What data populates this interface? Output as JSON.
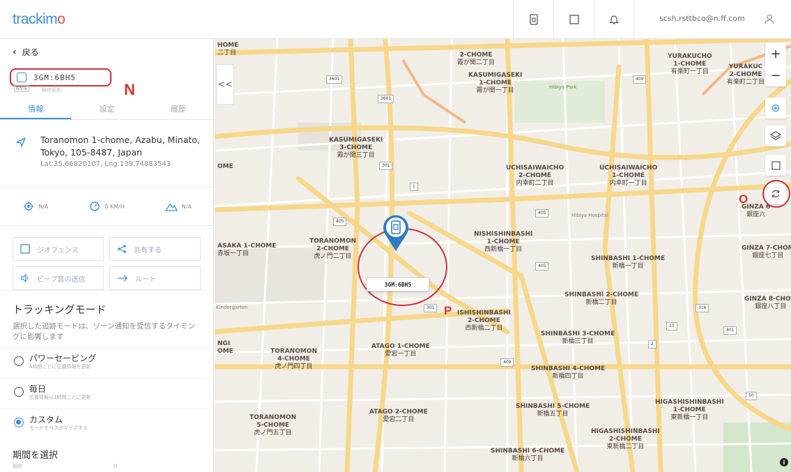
{
  "app": {
    "logo_text": "trackim",
    "logo_accent": "o",
    "user_email": "scsh.rsttbco@n.ff.com"
  },
  "panel": {
    "back_label": "戻る",
    "device_name": "3GM:6BH5",
    "battery": "65%",
    "device_sub": "最終更新",
    "annotation_n": "N",
    "tabs": [
      {
        "label": "情報"
      },
      {
        "label": "設定"
      },
      {
        "label": "履歴"
      }
    ],
    "address_line1": "Toranomon 1-chome, Azabu, Minato,",
    "address_line2": "Tokyo, 105-8487, Japan",
    "latlng": "Lat:35.66820107, Lng:139.74883543",
    "stats": [
      {
        "value": "N/A"
      },
      {
        "value": "0 KM/H"
      },
      {
        "value": "N/A"
      }
    ],
    "actions": [
      {
        "label": "ジオフェンス"
      },
      {
        "label": "共有する"
      },
      {
        "label": "ビープ音の送信"
      },
      {
        "label": "ルート"
      }
    ],
    "tracking_title": "トラッキングモード",
    "tracking_desc": "選択した追跡モードは、ゾーン通知を受信するタイミングに影響します",
    "modes": [
      {
        "name": "パワーセービング",
        "sub": "4時間ごとに位置情報を更新",
        "selected": false
      },
      {
        "name": "毎日",
        "sub": "位置情報は1時間ごとに更新",
        "selected": false
      },
      {
        "name": "カスタム",
        "sub": "モードをカスタマイズする",
        "selected": true
      }
    ],
    "period_title": "期間を選択",
    "period_sub": "期間",
    "period_sub2": "分"
  },
  "map": {
    "device_label": "3GM:6BH5",
    "annotation_o": "O",
    "annotation_p": "P",
    "collapse_label": "<<",
    "zoom_in": "+",
    "zoom_out": "−",
    "labels": [
      {
        "en": "YURAKUCHO\n1-CHOME",
        "jp": "有楽町一丁目"
      },
      {
        "en": "YURAKUC\n2-CHOME",
        "jp": "有楽町二丁目"
      },
      {
        "en": "KASUMIGASEKI\n1-CHOME",
        "jp": "霞が関一丁目"
      },
      {
        "en": "KASUMIGASEKI\n3-CHOME",
        "jp": "霞が関三丁目"
      },
      {
        "en": "UCHISAIWAICHO\n2-CHOME",
        "jp": "内幸町二丁目"
      },
      {
        "en": "UCHISAIWAICHO\n1-CHOME",
        "jp": "内幸町一丁目"
      },
      {
        "en": "NISHISHINBASHI\n1-CHOME",
        "jp": "西新橋一丁目"
      },
      {
        "en": "TORANOMON\n2-CHOME",
        "jp": "虎ノ門二丁目"
      },
      {
        "en": "ASAKA 1-CHOME",
        "jp": "赤坂一丁目"
      },
      {
        "en": "SHINBASHI 1-CHOME",
        "jp": "新橋一丁目"
      },
      {
        "en": "GINZA 7-CHOM",
        "jp": "銀座七丁目"
      },
      {
        "en": "GINZA 8-CHOM",
        "jp": "銀座八丁目"
      },
      {
        "en": "SHINBASHI 2-CHOME",
        "jp": "新橋二丁目"
      },
      {
        "en": "ISHISHINBASHI\n2-CHOME",
        "jp": "西新橋二丁目"
      },
      {
        "en": "SHINBASHI 3-CHOME",
        "jp": "新橋三丁目"
      },
      {
        "en": "ATAGO 1-CHOME",
        "jp": "愛宕一丁目"
      },
      {
        "en": "TORANOMON\n4-CHOME",
        "jp": "虎ノ門四丁目"
      },
      {
        "en": "SHINBASHI 4-CHOME",
        "jp": "新橋四丁目"
      },
      {
        "en": "HIGASHISHINBASHI\n1-CHOME",
        "jp": "東新橋一丁目"
      },
      {
        "en": "SHINBASHI 5-CHOME",
        "jp": "新橋五丁目"
      },
      {
        "en": "ATAGO 2-CHOME",
        "jp": "愛宕二丁目"
      },
      {
        "en": "TORANOMON\n5-CHOME",
        "jp": "虎ノ門五丁目"
      },
      {
        "en": "HIGASHISHINBASHI\n2-CHOME",
        "jp": "東新橋二丁目"
      },
      {
        "en": "SHINBASHI 6-CHOME",
        "jp": "新橋六丁目"
      },
      {
        "en": "GINZA 6",
        "jp": "銀座六"
      },
      {
        "en": "2-CHOME",
        "jp": "霞が関二丁目"
      },
      {
        "en": "HOME",
        "jp": "二丁目"
      },
      {
        "en": "OME",
        "jp": ""
      },
      {
        "en": "NGI\nOME",
        "jp": ""
      }
    ],
    "pois": [
      {
        "label": "Hibiya Park"
      },
      {
        "label": "Hibiya Hospital"
      },
      {
        "label": "Kindergarten"
      }
    ],
    "route_shields": [
      "3601",
      "405",
      "301",
      "409",
      "405",
      "401",
      "301",
      "405",
      "15",
      "409",
      "3601",
      "1",
      "2",
      "50",
      "316"
    ]
  },
  "colors": {
    "accent": "#3d8fd8",
    "annotation": "#d9332e",
    "map_bg": "#f2efe9",
    "road_major": "#f7d78a"
  }
}
